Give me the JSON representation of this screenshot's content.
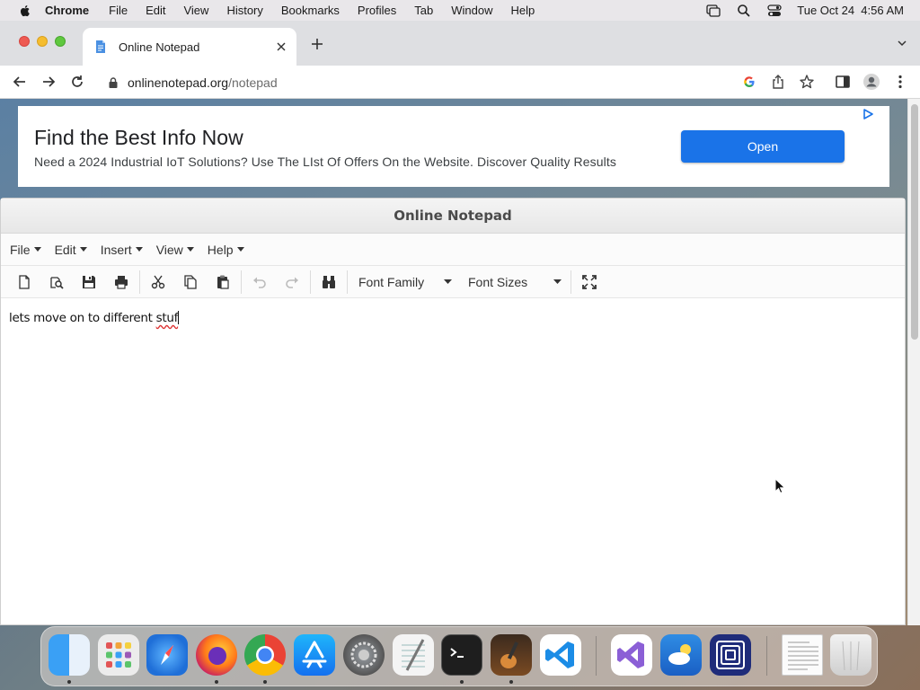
{
  "menubar": {
    "app": "Chrome",
    "items": [
      "File",
      "Edit",
      "View",
      "History",
      "Bookmarks",
      "Profiles",
      "Tab",
      "Window",
      "Help"
    ],
    "datetime": "Tue Oct 24  4:56 AM",
    "icons": [
      "screen-mirroring-icon",
      "spotlight-icon",
      "control-center-icon"
    ]
  },
  "browser": {
    "tab_title": "Online Notepad",
    "url_host": "onlinenotepad.org",
    "url_path": "/notepad"
  },
  "ad": {
    "title": "Find the Best Info Now",
    "text": "Need a 2024 Industrial IoT Solutions? Use The LIst Of Offers On the Website. Discover Quality Results",
    "button": "Open"
  },
  "notepad": {
    "title": "Online Notepad",
    "menus": [
      "File",
      "Edit",
      "Insert",
      "View",
      "Help"
    ],
    "font_family_label": "Font Family",
    "font_sizes_label": "Font Sizes",
    "content_before": "lets move on to different ",
    "content_misspelled": "stuf"
  },
  "dock": {
    "apps": [
      "Finder",
      "Launchpad",
      "Safari",
      "Firefox",
      "Chrome",
      "App Store",
      "System Preferences",
      "TextEdit",
      "Terminal",
      "GarageBand",
      "Visual Studio Code",
      "Visual Studio",
      "Weather",
      "Simulator",
      "Document",
      "Trash"
    ]
  },
  "colors": {
    "accent": "#1a73e8",
    "menubar_bg": "#e9e7ea",
    "tabstrip_bg": "#dedfe2"
  }
}
